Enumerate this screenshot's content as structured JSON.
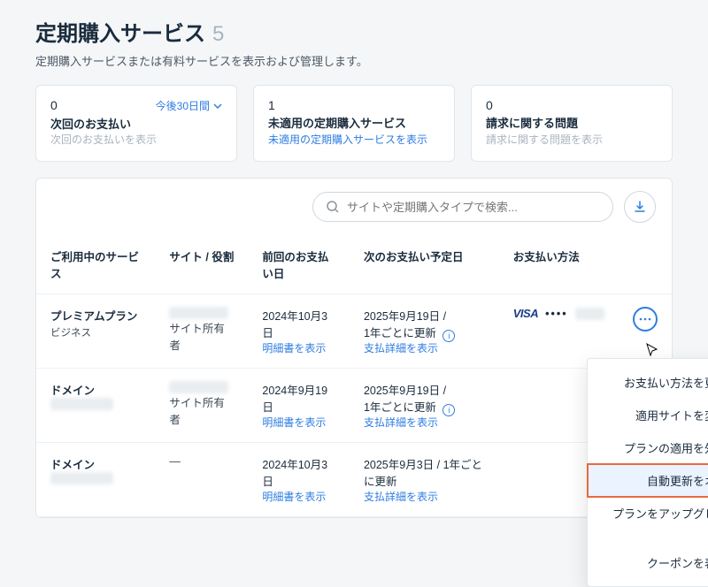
{
  "header": {
    "title": "定期購入サービス",
    "count": "5",
    "subtitle": "定期購入サービスまたは有料サービスを表示および管理します。"
  },
  "cards": {
    "upcoming": {
      "num": "0",
      "label": "次回のお支払い",
      "period": "今後30日間",
      "action": "次回のお支払いを表示"
    },
    "unapplied": {
      "num": "1",
      "label": "未適用の定期購入サービス",
      "action": "未適用の定期購入サービスを表示"
    },
    "issues": {
      "num": "0",
      "label": "請求に関する問題",
      "action": "請求に関する問題を表示"
    }
  },
  "search": {
    "placeholder": "サイトや定期購入タイプで検索..."
  },
  "table": {
    "headers": {
      "service": "ご利用中のサービス",
      "site": "サイト / 役割",
      "last": "前回のお支払い日",
      "next": "次のお支払い予定日",
      "method": "お支払い方法"
    },
    "rows": [
      {
        "service": "プレミアムプラン",
        "sub": "ビジネス",
        "role": "サイト所有者",
        "last_date": "2024年10月3日",
        "invoice": "明細書を表示",
        "next_date": "2025年9月19日 /",
        "renew": "1年ごとに更新",
        "detail": "支払詳細を表示",
        "pay_brand": "VISA",
        "pay_last": "••••",
        "has_menu": true
      },
      {
        "service": "ドメイン",
        "sub": "",
        "role": "サイト所有者",
        "last_date": "2024年9月19日",
        "invoice": "明細書を表示",
        "next_date": "2025年9月19日 /",
        "renew": "1年ごとに更新",
        "detail": "支払詳細を表示"
      },
      {
        "service": "ドメイン",
        "sub": "",
        "role": "—",
        "last_date": "2024年10月3日",
        "invoice": "明細書を表示",
        "next_date": "2025年9月3日 / 1年ごとに更新",
        "renew": "",
        "detail": "支払詳細を表示"
      }
    ]
  },
  "menu": {
    "update_payment": "お支払い方法を更新",
    "change_site": "適用サイトを変更",
    "remove_plan": "プランの適用を外す",
    "autorenew_off": "自動更新をオフ",
    "upgrade": "プランをアップグレード",
    "coupon": "クーポンを表示"
  }
}
